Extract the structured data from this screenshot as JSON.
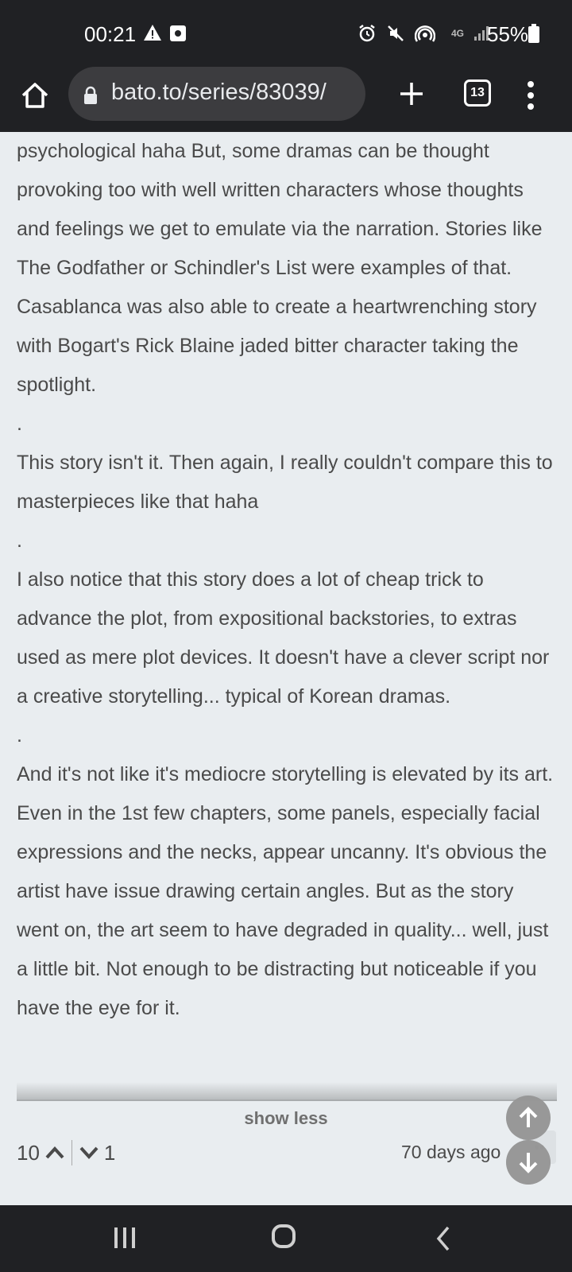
{
  "status_bar": {
    "time": "00:21",
    "network": "4G",
    "battery": "55%"
  },
  "browser": {
    "url": "bato.to/series/83039/",
    "tab_count": "13"
  },
  "comment": {
    "paragraphs": [
      "psychological haha But, some dramas can be thought provoking too with well written characters whose thoughts and feelings we get to emulate via the narration. Stories like The Godfather or Schindler's List were examples of that. Casablanca was also able to create a heartwrenching story with Bogart's Rick Blaine jaded bitter character taking the spotlight.",
      ".",
      "This story isn't it. Then again, I really couldn't compare this to masterpieces like that haha",
      ".",
      "I also notice that this story does a lot of cheap trick to advance the plot, from expositional backstories, to extras used as mere plot devices. It doesn't have a clever script nor a creative storytelling... typical of Korean dramas.",
      ".",
      "And it's not like it's mediocre storytelling is elevated by its art. Even in the 1st few chapters, some panels, especially facial expressions and the necks, appear uncanny. It's obvious the artist have issue drawing certain angles. But as the story went on, the art seem to have degraded in quality... well, just a little bit. Not enough to be distracting but noticeable if you have the eye for it."
    ],
    "show_less_label": "show less",
    "upvotes": "10",
    "downvotes": "1",
    "age": "70 days ago"
  },
  "colors": {
    "chrome_bg": "#202124",
    "page_bg": "#e9edf0",
    "text": "#4a4a4a"
  },
  "icons": [
    "warning-icon",
    "alarm-icon",
    "mute-icon",
    "hotspot-icon",
    "signal-icon",
    "battery-icon",
    "home-icon",
    "lock-icon",
    "plus-icon",
    "tabs-icon",
    "menu-icon",
    "arrow-up-icon",
    "arrow-down-icon",
    "chevron-up-icon",
    "chevron-down-icon",
    "recents-icon",
    "back-icon"
  ]
}
